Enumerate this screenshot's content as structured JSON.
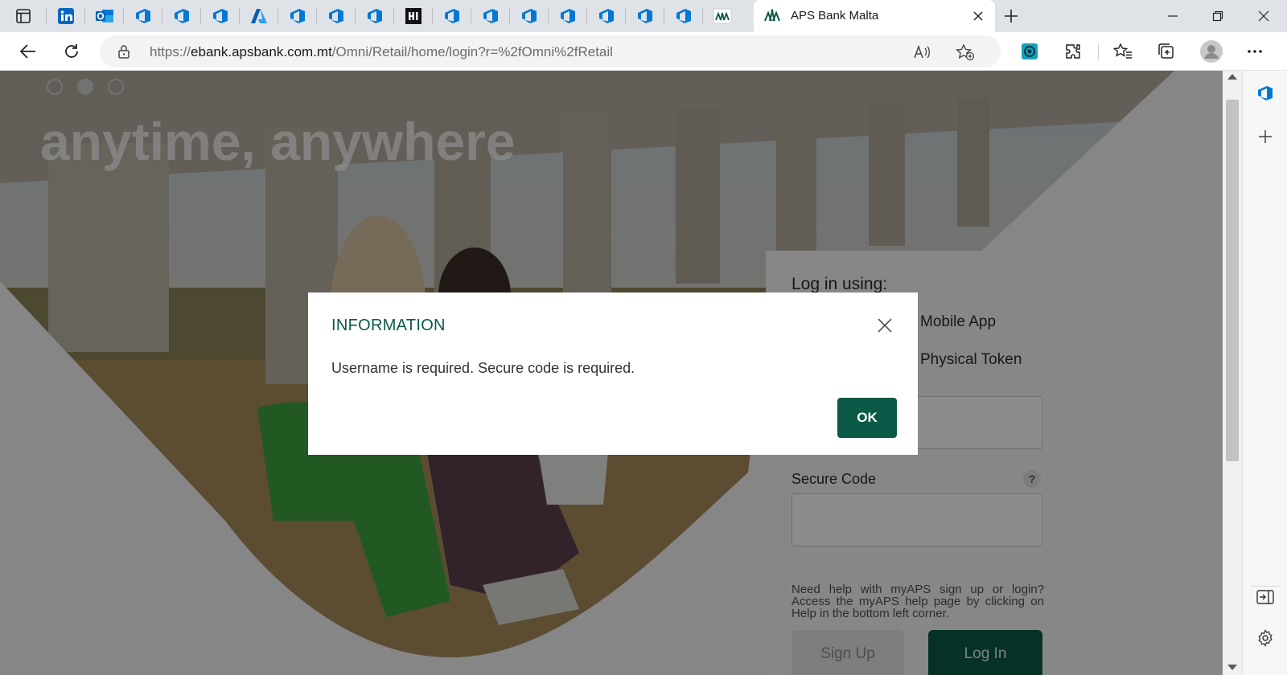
{
  "browser": {
    "active_tab": {
      "title": "APS Bank Malta"
    },
    "pinned_tabs": [
      "sidebar-toggle-icon",
      "linkedin-icon",
      "outlook-icon",
      "azure-devops-icon",
      "azure-devops-icon",
      "azure-devops-icon",
      "azure-icon",
      "azure-devops-icon",
      "azure-devops-icon",
      "azure-devops-icon",
      "hackernews-icon",
      "azure-devops-icon",
      "azure-devops-icon",
      "azure-devops-icon",
      "azure-devops-icon",
      "azure-devops-icon",
      "azure-devops-icon",
      "azure-devops-icon",
      "aps-bank-icon"
    ],
    "address": {
      "scheme": "https://",
      "domain": "ebank.apsbank.com.mt",
      "path": "/Omni/Retail/home/login?r=%2fOmni%2fRetail"
    }
  },
  "page": {
    "headline": "anytime, anywhere",
    "carousel": {
      "count": 3,
      "active_index": 1
    },
    "login": {
      "heading": "Log in using:",
      "option_mobile": "Mobile App",
      "option_token": "Physical Token",
      "secure_code_label": "Secure Code",
      "help_symbol": "?",
      "help_text": "Need help with myAPS sign up or login? Access the myAPS help page by clicking on Help in the bottom left corner.",
      "signup_label": "Sign Up",
      "login_label": "Log In"
    }
  },
  "dialog": {
    "title": "INFORMATION",
    "message": "Username is required. Secure code is required.",
    "ok_label": "OK"
  },
  "colors": {
    "brand_green": "#0b5a47",
    "tabstrip": "#dfe3e8",
    "overlay": "rgba(0,0,0,0.45)"
  }
}
